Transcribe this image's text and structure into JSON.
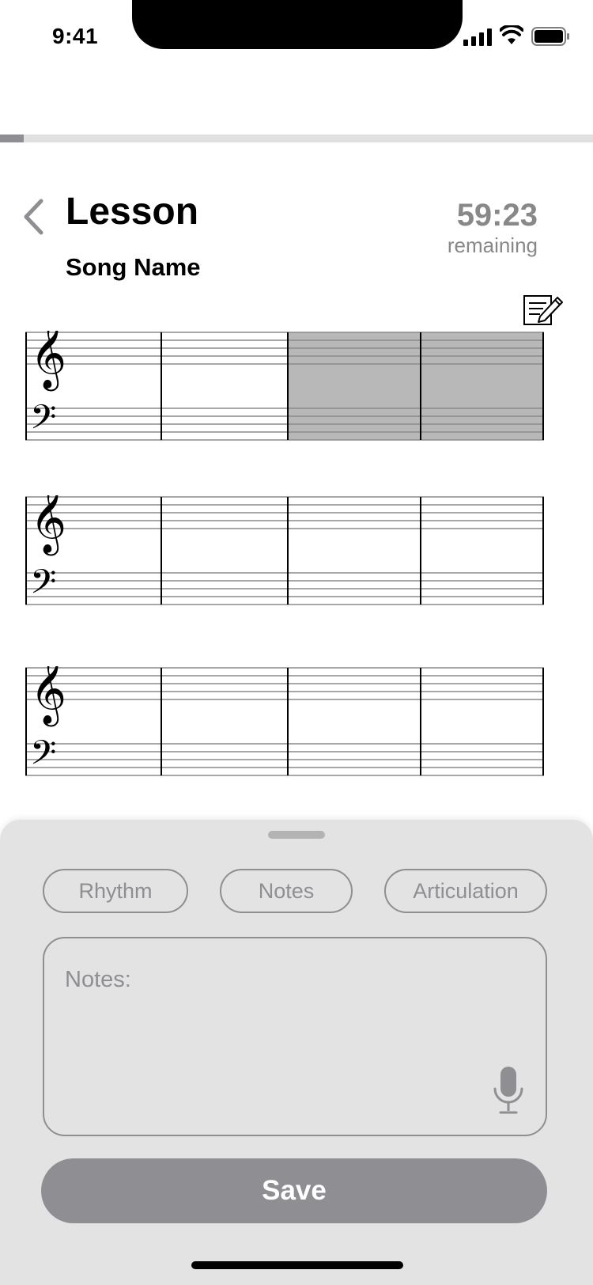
{
  "status_bar": {
    "time": "9:41"
  },
  "lesson_progress": 0.04,
  "header": {
    "title": "Lesson",
    "song_name": "Song Name",
    "timer_value": "59:23",
    "timer_label": "remaining"
  },
  "staves": [
    {
      "highlighted_measures": [
        3,
        4
      ]
    },
    {
      "highlighted_measures": []
    },
    {
      "highlighted_measures": []
    }
  ],
  "chips": [
    "Rhythm",
    "Notes",
    "Articulation"
  ],
  "notes_field": {
    "placeholder": "Notes:",
    "value": ""
  },
  "save_label": "Save",
  "icons": {
    "back": "chevron-left-icon",
    "edit": "edit-notes-icon",
    "mic": "microphone-icon",
    "treble": "treble-clef-icon",
    "bass": "bass-clef-icon"
  },
  "colors": {
    "accent_gray": "#8e8e93",
    "sheet_bg": "#e3e3e3",
    "highlight": "#b8b8b8"
  }
}
